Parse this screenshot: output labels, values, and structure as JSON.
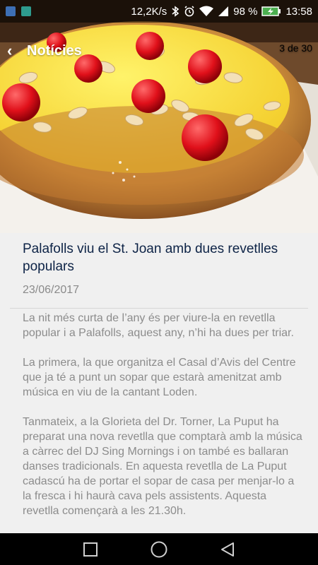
{
  "status_bar": {
    "speed": "12,2K/s",
    "battery": "98 %",
    "time": "13:58",
    "icons": [
      "usb-icon",
      "image-icon",
      "bluetooth-icon",
      "alarm-icon",
      "wifi-icon",
      "signal-icon",
      "battery-icon"
    ]
  },
  "app_bar": {
    "back_icon": "chevron-left-icon",
    "title": "Notícies",
    "counter": "3 de 30"
  },
  "article": {
    "title": "Palafolls viu el St. Joan amb dues revetlles populars",
    "date": "23/06/2017",
    "paragraphs": [
      "La nit més curta de l’any és per viure-la en revetlla popular i a Palafolls, aquest any, n’hi ha dues per triar.",
      "La primera, la que organitza el Casal d’Avis del Centre que ja té a punt un sopar que estarà amenitzat amb música en viu de la cantant Loden.",
      "Tanmateix, a la Glorieta del Dr. Torner, La Puput ha preparat una nova revetlla que comptarà amb la música a càrrec del DJ Sing Mornings i on també es ballaran danses tradicionals. En aquesta revetlla de La Puput cadascú ha de portar el sopar de casa per menjar-lo a la fresca i hi haurà cava pels assistents. Aquesta revetlla començarà a les 21.30h."
    ]
  },
  "nav_bar": {
    "icons": [
      "recents-square-icon",
      "home-circle-icon",
      "back-triangle-icon"
    ]
  },
  "colors": {
    "title": "#0d2346",
    "body_text": "#8c8c8c",
    "background": "#f0f0f0",
    "battery": "#4caf50"
  }
}
